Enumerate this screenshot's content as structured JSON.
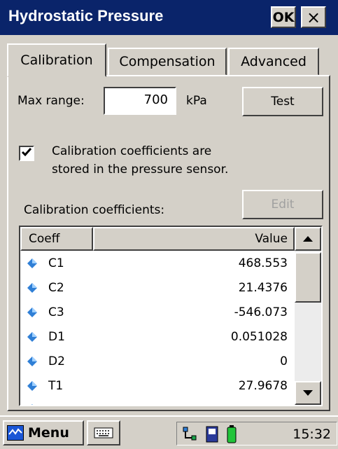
{
  "window": {
    "title": "Hydrostatic Pressure",
    "ok_label": "OK",
    "close_glyph": "×"
  },
  "tabs": [
    {
      "label": "Calibration",
      "active": true
    },
    {
      "label": "Compensation",
      "active": false
    },
    {
      "label": "Advanced",
      "active": false
    }
  ],
  "calibration": {
    "max_range_label": "Max range:",
    "max_range_value": "700",
    "unit": "kPa",
    "test_label": "Test",
    "stored_checked": true,
    "stored_line1": "Calibration coefficients are",
    "stored_line2": "stored in the pressure sensor.",
    "coefficients_label": "Calibration coefficients:",
    "edit_label": "Edit"
  },
  "coeff_table": {
    "headers": {
      "coeff": "Coeff",
      "value": "Value"
    },
    "rows": [
      {
        "coeff": "C1",
        "value": "468.553"
      },
      {
        "coeff": "C2",
        "value": "21.4376"
      },
      {
        "coeff": "C3",
        "value": "-546.073"
      },
      {
        "coeff": "D1",
        "value": "0.051028"
      },
      {
        "coeff": "D2",
        "value": "0"
      },
      {
        "coeff": "T1",
        "value": "27.9678"
      }
    ]
  },
  "taskbar": {
    "menu_label": "Menu",
    "clock": "15:32"
  },
  "icons": {
    "row_icon": "blue-diamond-icon",
    "keyboard": "keyboard-icon",
    "network": "network-icon",
    "card": "storage-card-icon",
    "battery": "battery-icon"
  },
  "colors": {
    "titlebar": "#0a246a",
    "window": "#d4d0c8",
    "diamond": "#2f7fd6"
  }
}
